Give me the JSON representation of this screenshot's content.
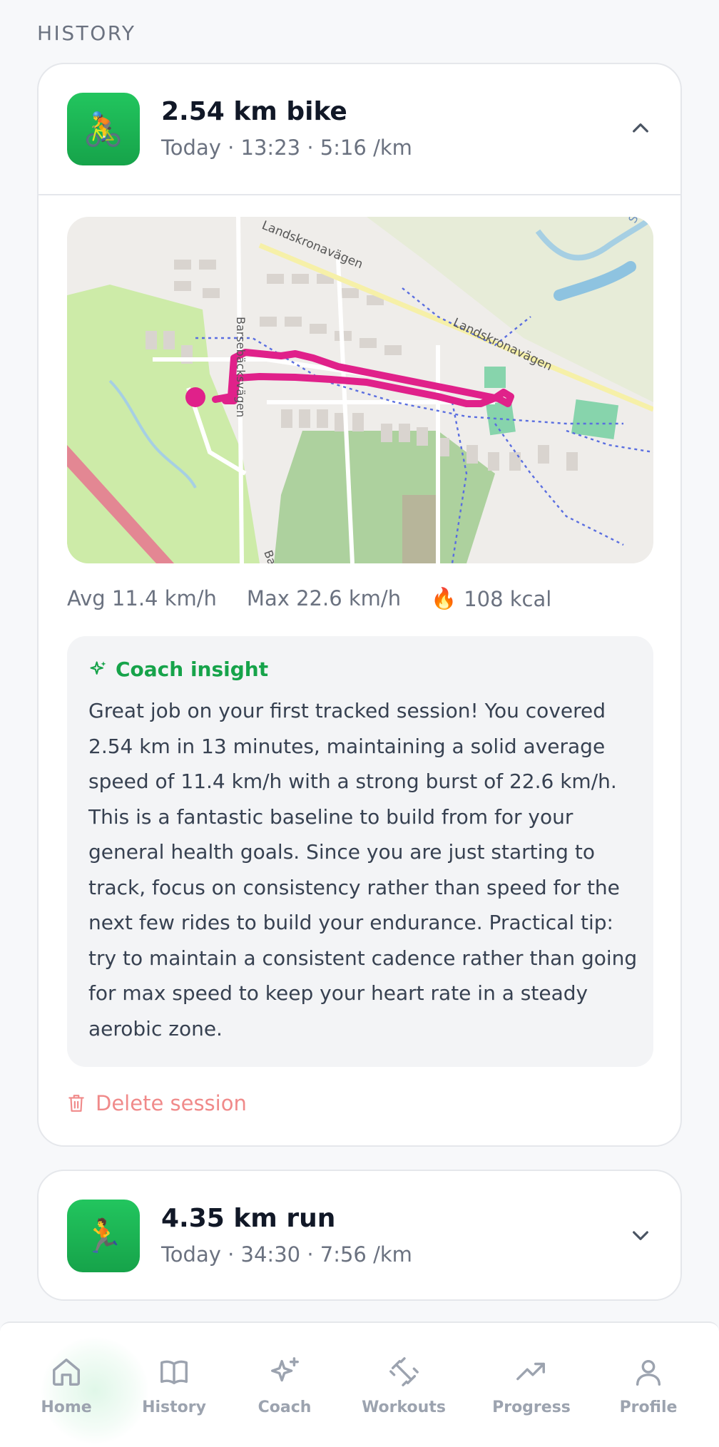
{
  "section_title": "HISTORY",
  "sessions": [
    {
      "icon": "🚴",
      "title": "2.54 km bike",
      "subtitle": "Today · 13:23 · 5:16 /km",
      "expanded": true,
      "stats": {
        "avg": "Avg 11.4 km/h",
        "max": "Max 22.6 km/h",
        "kcal_icon": "🔥",
        "kcal": "108 kcal"
      },
      "map_labels": [
        "Landskronavägen",
        "Landskronavägen",
        "Barsebäcksvägen",
        "Ba",
        "Sa"
      ],
      "insight": {
        "title": "Coach insight",
        "text": "Great job on your first tracked session! You covered 2.54 km in 13 minutes, maintaining a solid average speed of 11.4 km/h with a strong burst of 22.6 km/h. This is a fantastic baseline to build from for your general health goals. Since you are just starting to track, focus on consistency rather than speed for the next few rides to build your endurance. Practical tip: try to maintain a consistent cadence rather than going for max speed to keep your heart rate in a steady aerobic zone."
      },
      "delete_label": "Delete session"
    },
    {
      "icon": "🏃",
      "title": "4.35 km run",
      "subtitle": "Today · 34:30 · 7:56 /km",
      "expanded": false
    }
  ],
  "nav": {
    "active": "Home",
    "items": [
      "Home",
      "History",
      "Coach",
      "Workouts",
      "Progress",
      "Profile"
    ]
  },
  "colors": {
    "accent": "#16a34a",
    "route": "#e0218a",
    "danger": "#f08a8a"
  }
}
